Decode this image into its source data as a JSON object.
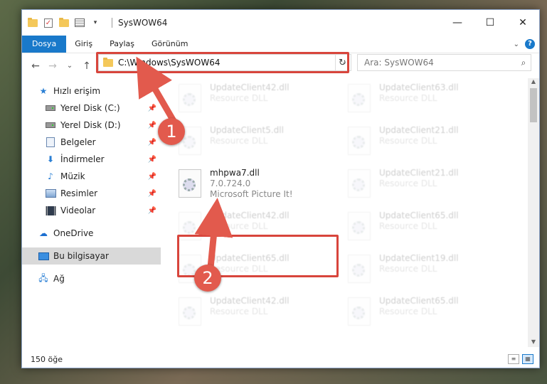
{
  "window": {
    "title": "SysWOW64",
    "min": "—",
    "max": "☐",
    "close": "✕"
  },
  "ribbon": {
    "tabs": [
      "Dosya",
      "Giriş",
      "Paylaş",
      "Görünüm"
    ],
    "help": "?"
  },
  "nav": {
    "back": "←",
    "forward": "→",
    "recent": "⌄",
    "up": "↑",
    "address": "C:\\Windows\\SysWOW64",
    "refresh": "↻",
    "search_placeholder": "Ara: SysWOW64"
  },
  "sidebar": {
    "items": [
      {
        "label": "Hızlı erişim"
      },
      {
        "label": "Yerel Disk (C:)"
      },
      {
        "label": "Yerel Disk (D:)"
      },
      {
        "label": "Belgeler"
      },
      {
        "label": "İndirmeler"
      },
      {
        "label": "Müzik"
      },
      {
        "label": "Resimler"
      },
      {
        "label": "Videolar"
      },
      {
        "label": "OneDrive"
      },
      {
        "label": "Bu bilgisayar"
      },
      {
        "label": "Ağ"
      }
    ]
  },
  "files": [
    {
      "name": "UpdateClient42.dll",
      "sub": "Resource DLL"
    },
    {
      "name": "UpdateClient63.dll",
      "sub": "Resource DLL"
    },
    {
      "name": "UpdateClient5.dll",
      "sub": "Resource DLL"
    },
    {
      "name": "UpdateClient21.dll",
      "sub": "Resource DLL"
    },
    {
      "name": "mhpwa7.dll",
      "sub": "7.0.724.0",
      "sub2": "Microsoft Picture It!"
    },
    {
      "name": "UpdateClient21.dll",
      "sub": "Resource DLL"
    },
    {
      "name": "UpdateClient42.dll",
      "sub": "Resource DLL"
    },
    {
      "name": "UpdateClient65.dll",
      "sub": "Resource DLL"
    },
    {
      "name": "UpdateClient65.dll",
      "sub": "Resource DLL"
    },
    {
      "name": "UpdateClient19.dll",
      "sub": "Resource DLL"
    },
    {
      "name": "UpdateClient42.dll",
      "sub": "Resource DLL"
    },
    {
      "name": "UpdateClient65.dll",
      "sub": "Resource DLL"
    }
  ],
  "status": {
    "count": "150 öğe"
  },
  "callouts": [
    "1",
    "2"
  ],
  "colors": {
    "accent": "#1979ca",
    "highlight": "#d8453c",
    "callout": "#e25a4d"
  }
}
